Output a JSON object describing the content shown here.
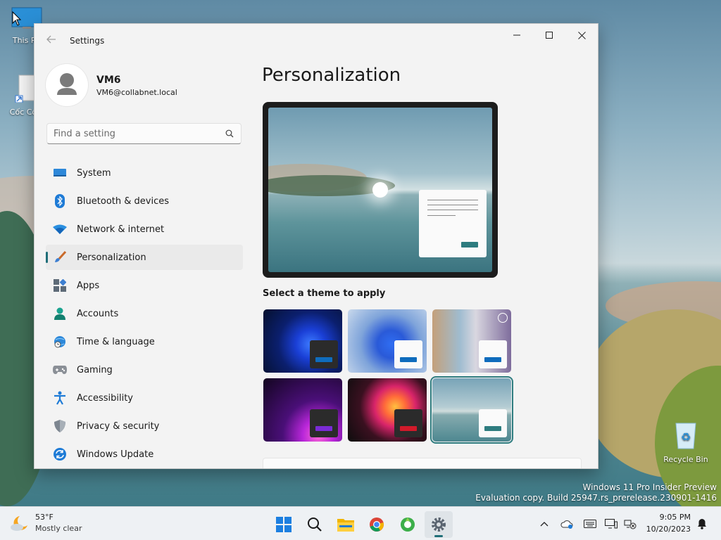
{
  "desktop": {
    "icons": [
      {
        "label": "This PC"
      },
      {
        "label": "Cốc Cốc"
      },
      {
        "label": "Recycle Bin"
      }
    ],
    "watermark": {
      "line1": "Windows 11 Pro Insider Preview",
      "line2": "Evaluation copy. Build 25947.rs_prerelease.230901-1416"
    }
  },
  "window": {
    "title": "Settings",
    "account": {
      "name": "VM6",
      "email": "VM6@collabnet.local"
    },
    "search": {
      "placeholder": "Find a setting",
      "value": ""
    },
    "nav": [
      {
        "label": "System",
        "icon": "system-icon"
      },
      {
        "label": "Bluetooth & devices",
        "icon": "bluetooth-icon"
      },
      {
        "label": "Network & internet",
        "icon": "wifi-icon"
      },
      {
        "label": "Personalization",
        "icon": "brush-icon",
        "selected": true
      },
      {
        "label": "Apps",
        "icon": "apps-icon"
      },
      {
        "label": "Accounts",
        "icon": "person-icon"
      },
      {
        "label": "Time & language",
        "icon": "globe-clock-icon"
      },
      {
        "label": "Gaming",
        "icon": "controller-icon"
      },
      {
        "label": "Accessibility",
        "icon": "accessibility-icon"
      },
      {
        "label": "Privacy & security",
        "icon": "shield-icon"
      },
      {
        "label": "Windows Update",
        "icon": "sync-icon"
      }
    ],
    "content": {
      "page_title": "Personalization",
      "theme_section_label": "Select a theme to apply",
      "themes": [
        {
          "name": "dark-bloom",
          "selected": false,
          "accent": "#0f6cbd"
        },
        {
          "name": "light-bloom",
          "selected": false,
          "accent": "#0f6cbd"
        },
        {
          "name": "spotlight-slideshow",
          "selected": false,
          "accent": "#0f6cbd"
        },
        {
          "name": "glow",
          "selected": false,
          "accent": "#7a2bd6"
        },
        {
          "name": "captured-motion",
          "selected": false,
          "accent": "#d11a2a"
        },
        {
          "name": "lake",
          "selected": true,
          "accent": "#2e7c7f"
        }
      ]
    }
  },
  "taskbar": {
    "weather": {
      "temp": "53°F",
      "condition": "Mostly clear"
    },
    "clock": {
      "time": "9:05 PM",
      "date": "10/20/2023"
    }
  },
  "colors": {
    "accent": "#1f6e78",
    "window_bg": "#f3f3f3"
  }
}
